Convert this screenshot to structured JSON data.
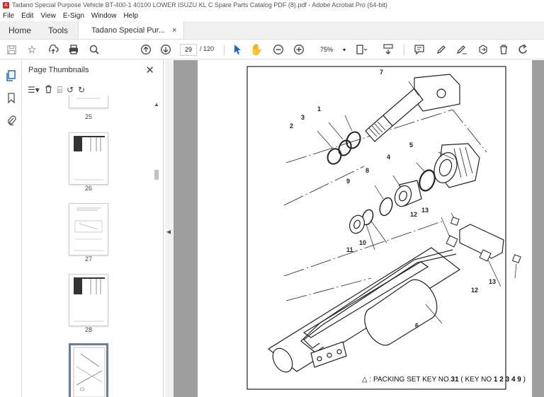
{
  "window": {
    "title": "Tadano Special Purpose Vehicle BT-400-1 40100 LOWER ISUZU KL C Spare Parts Catalog PDF (8).pdf - Adobe Acrobat Pro (64-bit)"
  },
  "menu": [
    "File",
    "Edit",
    "View",
    "E-Sign",
    "Window",
    "Help"
  ],
  "tabs": {
    "home": "Home",
    "tools": "Tools",
    "document": "Tadano Special Pur...",
    "close": "×"
  },
  "toolbar": {
    "page_current": "29",
    "page_total": "/ 120",
    "zoom": "75%"
  },
  "thumbnails": {
    "header": "Page Thumbnails",
    "pages": [
      {
        "label": "25"
      },
      {
        "label": "26"
      },
      {
        "label": "27"
      },
      {
        "label": "28"
      }
    ]
  },
  "diagram": {
    "callouts": [
      "7",
      "1",
      "3",
      "2",
      "5",
      "4",
      "8",
      "9",
      "12",
      "13",
      "11",
      "10",
      "12",
      "13",
      "6"
    ],
    "caption_prefix": "△ : PACKING SET KEY NO.",
    "caption_key": "31",
    "caption_mid": " ( KEY NO ",
    "caption_keys": "1 2 3 4 9",
    "caption_end": " )"
  }
}
